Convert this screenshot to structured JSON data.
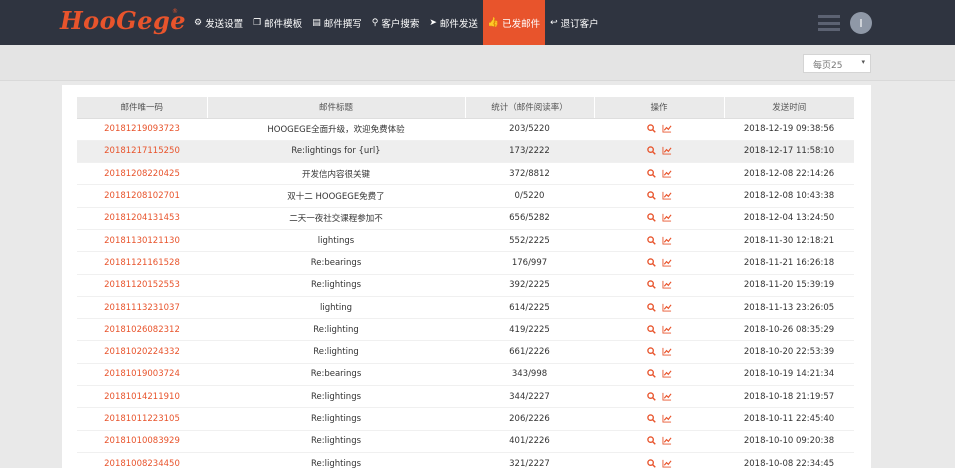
{
  "brand": {
    "logo_text": "HooGege",
    "reg_mark": "®"
  },
  "nav": [
    {
      "icon": "gear-icon",
      "glyph": "⚙",
      "label": "发送设置",
      "active": false
    },
    {
      "icon": "copy-icon",
      "glyph": "❐",
      "label": "邮件模板",
      "active": false
    },
    {
      "icon": "file-icon",
      "glyph": "▤",
      "label": "邮件撰写",
      "active": false
    },
    {
      "icon": "search-icon",
      "glyph": "⚲",
      "label": "客户搜索",
      "active": false
    },
    {
      "icon": "send-icon",
      "glyph": "➤",
      "label": "邮件发送",
      "active": false
    },
    {
      "icon": "thumbs-up-icon",
      "glyph": "👍",
      "label": "已发邮件",
      "active": true
    },
    {
      "icon": "reply-icon",
      "glyph": "↩",
      "label": "退订客户",
      "active": false
    }
  ],
  "user": {
    "avatar_letter": "I"
  },
  "toolbar": {
    "page_size_label": "每页25",
    "caret": "▾"
  },
  "table": {
    "headers": [
      "邮件唯一码",
      "邮件标题",
      "统计（邮件阅读率）",
      "操作",
      "发送时间"
    ],
    "rows": [
      {
        "uid": "20181219093723",
        "title": "HOOGEGE全面升级，欢迎免费体验",
        "stats": "203/5220",
        "time": "2018-12-19 09:38:56"
      },
      {
        "uid": "20181217115250",
        "title": "Re:lightings for {url}",
        "stats": "173/2222",
        "time": "2018-12-17 11:58:10"
      },
      {
        "uid": "20181208220425",
        "title": "开发信内容很关键",
        "stats": "372/8812",
        "time": "2018-12-08 22:14:26"
      },
      {
        "uid": "20181208102701",
        "title": "双十二 HOOGEGE免费了",
        "stats": "0/5220",
        "time": "2018-12-08 10:43:38"
      },
      {
        "uid": "20181204131453",
        "title": "二天一夜社交课程参加不",
        "stats": "656/5282",
        "time": "2018-12-04 13:24:50"
      },
      {
        "uid": "20181130121130",
        "title": "lightings",
        "stats": "552/2225",
        "time": "2018-11-30 12:18:21"
      },
      {
        "uid": "20181121161528",
        "title": "Re:bearings",
        "stats": "176/997",
        "time": "2018-11-21 16:26:18"
      },
      {
        "uid": "20181120152553",
        "title": "Re:lightings",
        "stats": "392/2225",
        "time": "2018-11-20 15:39:19"
      },
      {
        "uid": "20181113231037",
        "title": "lighting",
        "stats": "614/2225",
        "time": "2018-11-13 23:26:05"
      },
      {
        "uid": "20181026082312",
        "title": "Re:lighting",
        "stats": "419/2225",
        "time": "2018-10-26 08:35:29"
      },
      {
        "uid": "20181020224332",
        "title": "Re:lighting",
        "stats": "661/2226",
        "time": "2018-10-20 22:53:39"
      },
      {
        "uid": "20181019003724",
        "title": "Re:bearings",
        "stats": "343/998",
        "time": "2018-10-19 14:21:34"
      },
      {
        "uid": "20181014211910",
        "title": "Re:lightings",
        "stats": "344/2227",
        "time": "2018-10-18 21:19:57"
      },
      {
        "uid": "20181011223105",
        "title": "Re:lightings",
        "stats": "206/2226",
        "time": "2018-10-11 22:45:40"
      },
      {
        "uid": "20181010083929",
        "title": "Re:lightings",
        "stats": "401/2226",
        "time": "2018-10-10 09:20:38"
      },
      {
        "uid": "20181008234450",
        "title": "Re:lightings",
        "stats": "321/2227",
        "time": "2018-10-08 22:34:45"
      }
    ],
    "action_icons": [
      "search-icon",
      "line-chart-icon"
    ],
    "accent_color": "#e8542c"
  }
}
